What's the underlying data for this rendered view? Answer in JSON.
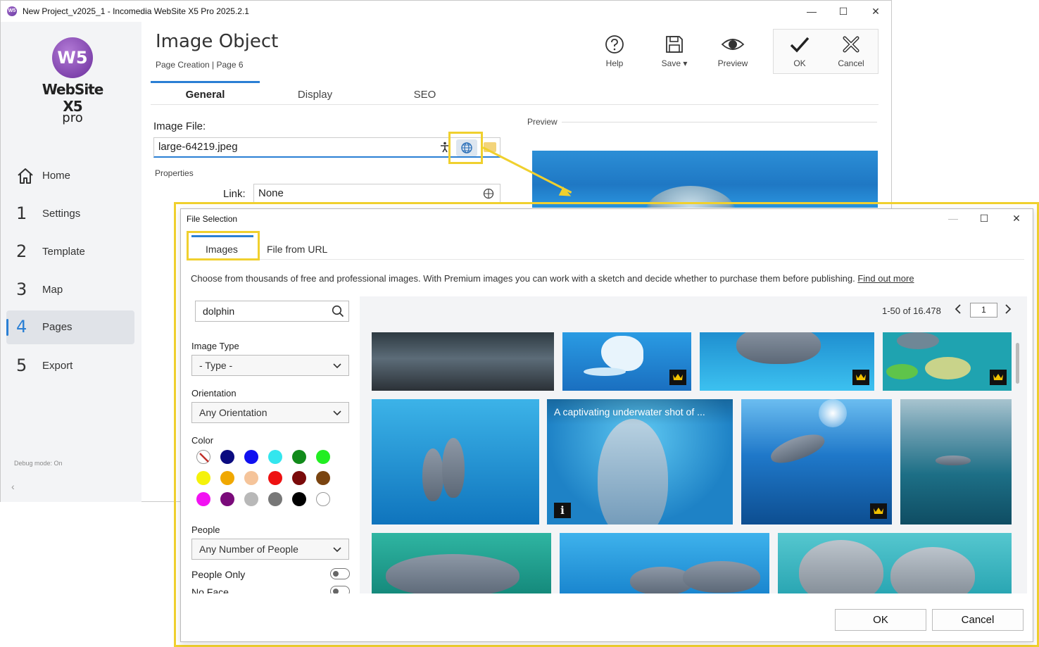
{
  "window": {
    "title": "New Project_v2025_1 - Incomedia WebSite X5 Pro 2025.2.1",
    "app_icon": "W5"
  },
  "brand": {
    "logo_mark": "W5",
    "name": "WebSite X5",
    "edition": "pro"
  },
  "sidebar": {
    "items": [
      {
        "num": "",
        "label": "Home",
        "icon": "home-icon"
      },
      {
        "num": "1",
        "label": "Settings"
      },
      {
        "num": "2",
        "label": "Template"
      },
      {
        "num": "3",
        "label": "Map"
      },
      {
        "num": "4",
        "label": "Pages",
        "active": true
      },
      {
        "num": "5",
        "label": "Export"
      }
    ],
    "debug": "Debug mode: On",
    "collapse": "‹"
  },
  "header": {
    "title": "Image Object",
    "subtitle": "Page Creation | Page 6"
  },
  "toolbar": {
    "help": "Help",
    "save": "Save ▾",
    "preview": "Preview",
    "ok": "OK",
    "cancel": "Cancel"
  },
  "tabs": [
    "General",
    "Display",
    "SEO"
  ],
  "form": {
    "image_file_label": "Image File:",
    "image_file_value": "large-64219.jpeg",
    "properties_label": "Properties",
    "link_label": "Link:",
    "link_value": "None",
    "preview_label": "Preview"
  },
  "dialog": {
    "title": "File Selection",
    "tabs": [
      "Images",
      "File from URL"
    ],
    "description": "Choose from thousands of free and professional images. With Premium images you can work with a sketch and decide whether to purchase them before publishing.",
    "find_out_more": "Find out more",
    "search_value": "dolphin",
    "image_type_label": "Image Type",
    "image_type_value": "- Type -",
    "orientation_label": "Orientation",
    "orientation_value": "Any Orientation",
    "color_label": "Color",
    "colors": [
      "none",
      "#0b0b80",
      "#1010f0",
      "#33e6ee",
      "#118a1a",
      "#22ee22",
      "#f5f20a",
      "#f0a800",
      "#f5c49a",
      "#ee1111",
      "#7a0a0a",
      "#7a4410",
      "#f212f2",
      "#7a0a7a",
      "#b8b8b8",
      "#777777",
      "#000000",
      "#ffffff"
    ],
    "people_label": "People",
    "people_value": "Any Number of People",
    "people_only_label": "People Only",
    "no_face_label": "No Face",
    "pager_text": "1-50 of 16.478",
    "page_value": "1",
    "caption": "A captivating underwater shot of ...",
    "info_badge": "i",
    "ok": "OK",
    "cancel": "Cancel"
  },
  "colors": {
    "accent": "#2a7fd4",
    "highlight": "#f0d02e",
    "sidebar_bg": "#f3f4f6"
  }
}
